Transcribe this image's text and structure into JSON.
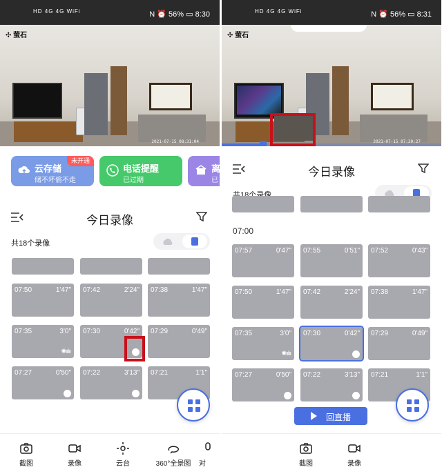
{
  "left": {
    "status": {
      "icons": "HD 4G 4G WiFi",
      "battery": "56%",
      "time": "8:30"
    },
    "logo": "萤石",
    "timestamp": "2021-07-15 08:31:04",
    "cards": [
      {
        "title": "云存储",
        "subtitle": "储不坏偷不走",
        "tag": "未开通",
        "color": "#7a9be6"
      },
      {
        "title": "电话提醒",
        "subtitle": "已过期",
        "color": "#46c96a"
      },
      {
        "title": "离",
        "subtitle": "已",
        "color": "#9b86e6"
      }
    ],
    "header": {
      "title": "今日录像"
    },
    "count": "共18个录像",
    "rows": [
      [
        {
          "time": "07:50",
          "dur": "1'47\""
        },
        {
          "time": "07:42",
          "dur": "2'24\""
        },
        {
          "time": "07:38",
          "dur": "1'47\""
        }
      ],
      [
        {
          "time": "07:35",
          "dur": "3'0\""
        },
        {
          "time": "07:30",
          "dur": "0'42\""
        },
        {
          "time": "07:29",
          "dur": "0'49\""
        }
      ],
      [
        {
          "time": "07:27",
          "dur": "0'50\""
        },
        {
          "time": "07:22",
          "dur": "3'13\""
        },
        {
          "time": "07:21",
          "dur": "1'1\""
        }
      ]
    ],
    "toolbar": [
      "截图",
      "录像",
      "云台",
      "360°全景图",
      "对"
    ]
  },
  "right": {
    "status": {
      "icons": "HD 4G 4G WiFi",
      "battery": "56%",
      "time": "8:31"
    },
    "logo": "萤石",
    "timestamp": "2021-07-15 07:30:27",
    "progress": 0.19,
    "header": {
      "title": "今日录像"
    },
    "count": "共18个录像",
    "section": "07:00",
    "rows": [
      [
        {
          "time": "07:57",
          "dur": "0'47\""
        },
        {
          "time": "07:55",
          "dur": "0'51\""
        },
        {
          "time": "07:52",
          "dur": "0'43\""
        }
      ],
      [
        {
          "time": "07:50",
          "dur": "1'47\""
        },
        {
          "time": "07:42",
          "dur": "2'24\""
        },
        {
          "time": "07:38",
          "dur": "1'47\""
        }
      ],
      [
        {
          "time": "07:35",
          "dur": "3'0\""
        },
        {
          "time": "07:30",
          "dur": "0'42\""
        },
        {
          "time": "07:29",
          "dur": "0'49\""
        }
      ],
      [
        {
          "time": "07:27",
          "dur": "0'50\""
        },
        {
          "time": "07:22",
          "dur": "3'13\""
        },
        {
          "time": "07:21",
          "dur": "1'1\""
        }
      ]
    ],
    "playback_label": "回直播",
    "toolbar": [
      "截图",
      "录像"
    ]
  },
  "icons": {
    "menu": "menu-collapse-icon",
    "filter": "filter-icon",
    "cloud": "cloud-icon",
    "sd": "sd-card-icon",
    "grid": "grid-icon",
    "camera": "camera-icon",
    "video": "video-icon",
    "ptz": "ptz-icon",
    "panorama": "panorama-icon",
    "sound": "sound-wave-icon",
    "pet": "pet-icon",
    "play": "play-icon"
  },
  "colors": {
    "accent": "#4a6fe0",
    "highlight_box": "#c8101a",
    "tile": "#a8a9ae",
    "tag": "#ff5b5b"
  }
}
